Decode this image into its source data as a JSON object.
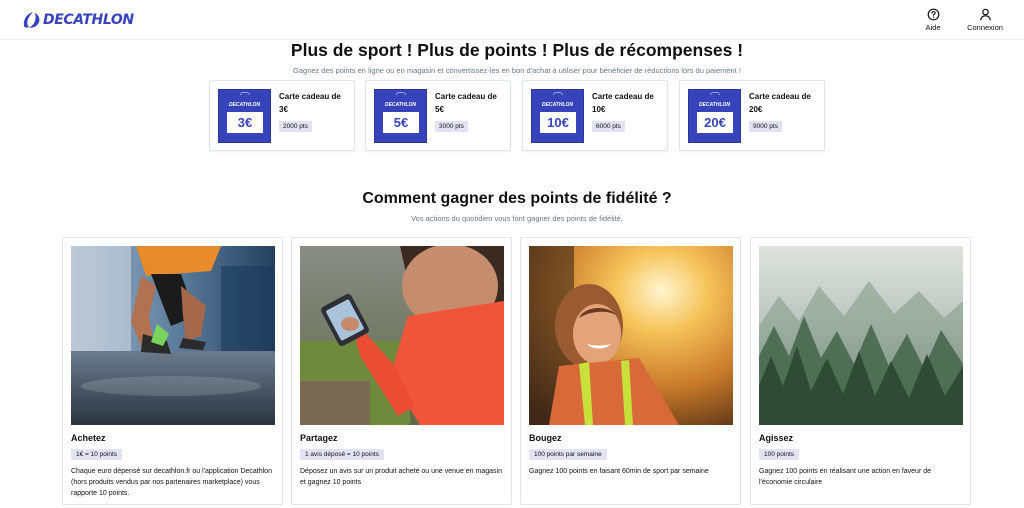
{
  "header": {
    "brand": "DECATHLON",
    "help_label": "Aide",
    "login_label": "Connexion"
  },
  "hero": {
    "title": "Plus de sport ! Plus de points ! Plus de récompenses !",
    "subtitle": "Gagnez des points en ligne ou en magasin et convertissez-les en bon d'achat à utiliser pour bénéficier de réductions lors du paiement !"
  },
  "gift_cards": [
    {
      "brand": "DECATHLON",
      "value": "3€",
      "title": "Carte cadeau de 3€",
      "points": "2000 pts"
    },
    {
      "brand": "DECATHLON",
      "value": "5€",
      "title": "Carte cadeau de 5€",
      "points": "3000 pts"
    },
    {
      "brand": "DECATHLON",
      "value": "10€",
      "title": "Carte cadeau de 10€",
      "points": "6000 pts"
    },
    {
      "brand": "DECATHLON",
      "value": "20€",
      "title": "Carte cadeau de 20€",
      "points": "9000 pts"
    }
  ],
  "section2": {
    "title": "Comment gagner des points de fidélité ?",
    "subtitle": "Vos actions du quotidien vous font gagner des points de fidélité."
  },
  "actions": [
    {
      "title": "Achetez",
      "badge": "1€ = 10 points",
      "description": "Chaque euro dépensé sur decathlon.fr ou l'application Decathlon (hors produits vendus par nos partenaires marketplace) vous rapporte 10 points."
    },
    {
      "title": "Partagez",
      "badge": "1 avis déposé = 10 points",
      "description": "Déposez un avis sur un produit acheté ou une venue en magasin et gagnez 10 points"
    },
    {
      "title": "Bougez",
      "badge": "100 points par semaine",
      "description": "Gagnez 100 points en faisant 60min de sport par semaine"
    },
    {
      "title": "Agissez",
      "badge": "100 points",
      "description": "Gagnez 100 points en réalisant une action en faveur de l'économie circulaire"
    }
  ],
  "colors": {
    "brand_blue": "#3643ba",
    "badge_bg": "#e1e3f5",
    "muted_text": "#687787"
  },
  "icons": {
    "help": "question-circle-icon",
    "login": "user-icon",
    "logo": "decathlon-logo-icon"
  }
}
